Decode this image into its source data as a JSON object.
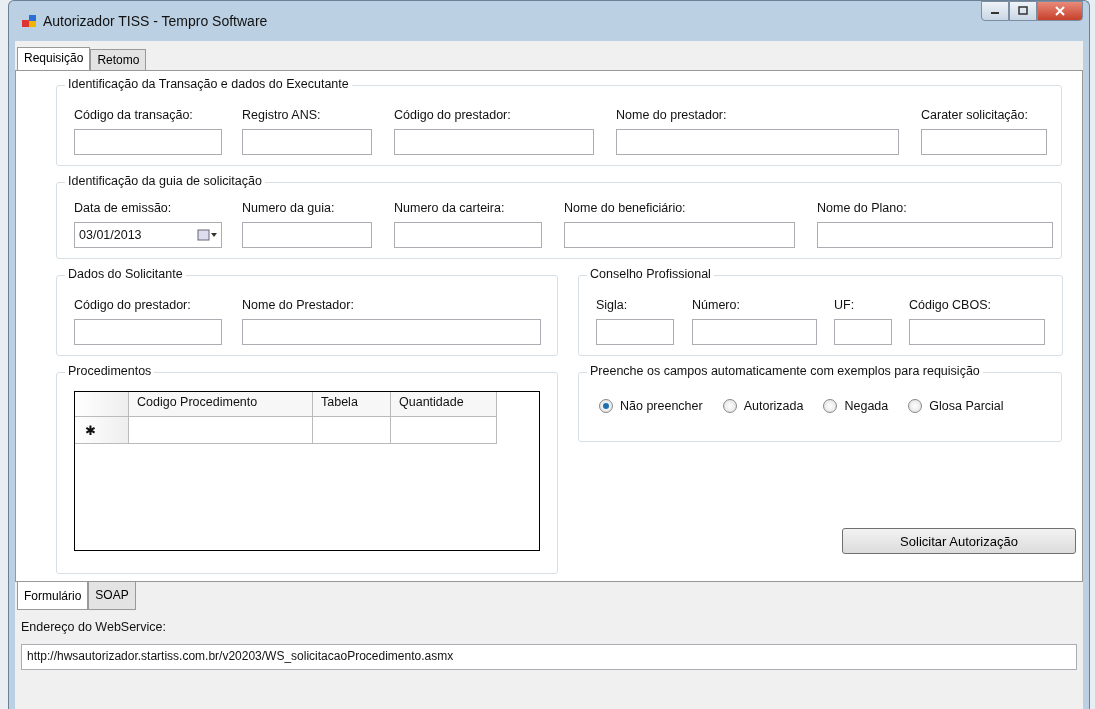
{
  "window": {
    "title": "Autorizador TISS - Tempro Software"
  },
  "tabs": [
    {
      "label": "Requisição",
      "selected": true
    },
    {
      "label": "Retomo",
      "selected": false
    }
  ],
  "groups": [
    {
      "title": "Identificação da Transação e dados do Executante",
      "fields": [
        {
          "label": "Código da transação:"
        },
        {
          "label": "Registro ANS:"
        },
        {
          "label": "Código do prestador:"
        },
        {
          "label": "Nome do prestador:"
        },
        {
          "label": "Carater solicitação:"
        }
      ]
    },
    {
      "title": "Identificação da guia de solicitação",
      "fields": [
        {
          "label": "Data de emissão:",
          "kind": "date",
          "value": "03/01/2013"
        },
        {
          "label": "Numero da guia:"
        },
        {
          "label": "Numero da carteira:"
        },
        {
          "label": "Nome do beneficiário:"
        },
        {
          "label": "Nome do Plano:"
        }
      ]
    },
    {
      "title": "Dados do Solicitante",
      "fields": [
        {
          "label": "Código do prestador:"
        },
        {
          "label": "Nome do Prestador:"
        }
      ]
    },
    {
      "title": "Conselho Profissional",
      "fields": [
        {
          "label": "Sigla:"
        },
        {
          "label": "Número:"
        },
        {
          "label": "UF:"
        },
        {
          "label": "Código CBOS:"
        }
      ]
    }
  ],
  "procedures": {
    "title": "Procedimentos",
    "columns": [
      "Codigo Procedimento",
      "Tabela",
      "Quantidade"
    ],
    "new_row_marker": "✱"
  },
  "autofill": {
    "title": "Preenche os campos automaticamente com exemplos para requisição",
    "options": [
      {
        "label": "Não preencher",
        "selected": true
      },
      {
        "label": "Autorizada",
        "selected": false
      },
      {
        "label": "Negada",
        "selected": false
      },
      {
        "label": "Glosa Parcial",
        "selected": false
      }
    ]
  },
  "submit_button": "Solicitar Autorização",
  "bottom_tabs": [
    {
      "label": "Formulário",
      "selected": true
    },
    {
      "label": "SOAP",
      "selected": false
    }
  ],
  "webservice": {
    "label": "Endereço do WebService:",
    "value": "http://hwsautorizador.startiss.com.br/v20203/WS_solicitacaoProcedimento.asmx"
  }
}
